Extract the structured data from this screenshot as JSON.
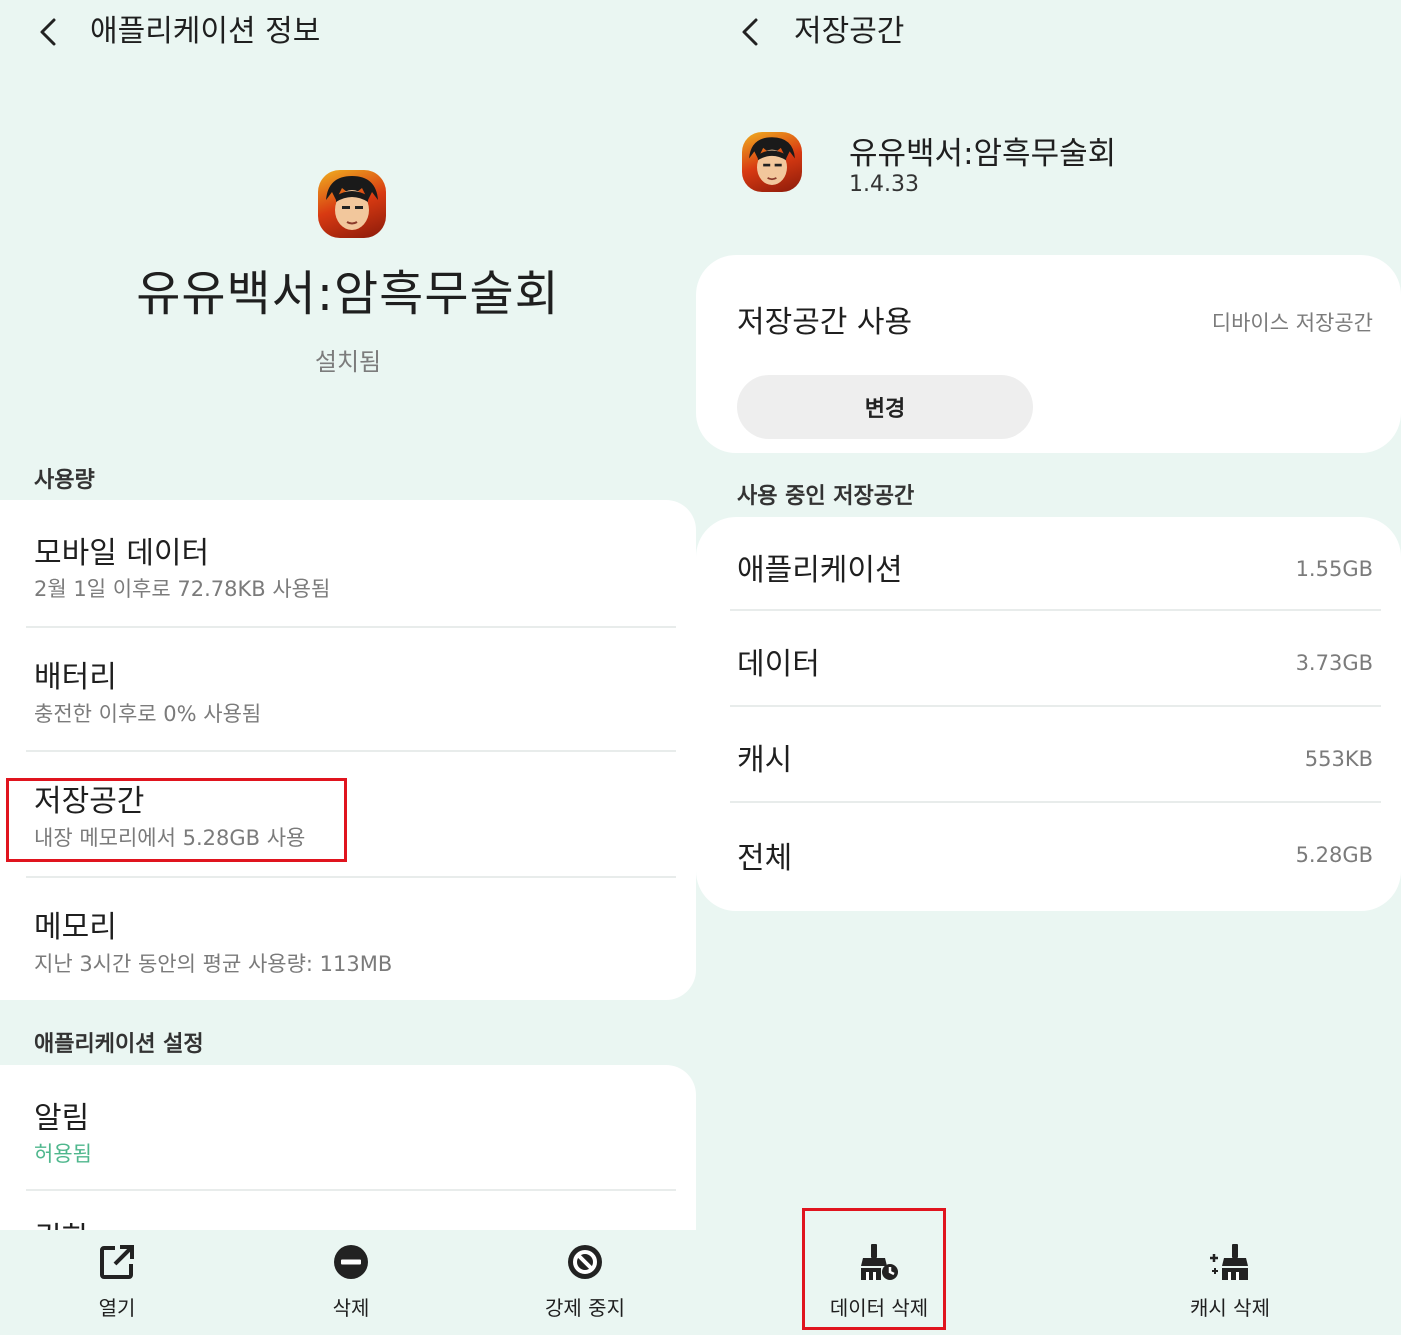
{
  "left": {
    "header": {
      "title": "애플리케이션 정보"
    },
    "app": {
      "name": "유유백서:암흑무술회",
      "status": "설치됨"
    },
    "usage": {
      "label": "사용량",
      "items": [
        {
          "title": "모바일 데이터",
          "subtitle": "2월 1일 이후로 72.78KB 사용됨"
        },
        {
          "title": "배터리",
          "subtitle": "충전한 이후로 0% 사용됨"
        },
        {
          "title": "저장공간",
          "subtitle": "내장 메모리에서 5.28GB 사용"
        },
        {
          "title": "메모리",
          "subtitle": "지난 3시간 동안의 평균 사용량: 113MB"
        }
      ]
    },
    "settings": {
      "label": "애플리케이션 설정",
      "items": [
        {
          "title": "알림",
          "subtitle": "허용됨"
        },
        {
          "title": "권한"
        }
      ]
    },
    "bottom": {
      "open": "열기",
      "uninstall": "삭제",
      "force_stop": "강제 중지"
    }
  },
  "right": {
    "header": {
      "title": "저장공간"
    },
    "app": {
      "name": "유유백서:암흑무술회",
      "version": "1.4.33"
    },
    "storage_used": {
      "title": "저장공간 사용",
      "value": "디바이스 저장공간",
      "change_label": "변경"
    },
    "in_use": {
      "label": "사용 중인 저장공간",
      "rows": [
        {
          "name": "애플리케이션",
          "value": "1.55GB"
        },
        {
          "name": "데이터",
          "value": "3.73GB"
        },
        {
          "name": "캐시",
          "value": "553KB"
        },
        {
          "name": "전체",
          "value": "5.28GB"
        }
      ]
    },
    "bottom": {
      "clear_data": "데이터 삭제",
      "clear_cache": "캐시 삭제"
    }
  },
  "colors": {
    "background": "#eaf6f2",
    "card": "#ffffff",
    "highlight": "#e0141e",
    "green": "#4fb78d"
  }
}
